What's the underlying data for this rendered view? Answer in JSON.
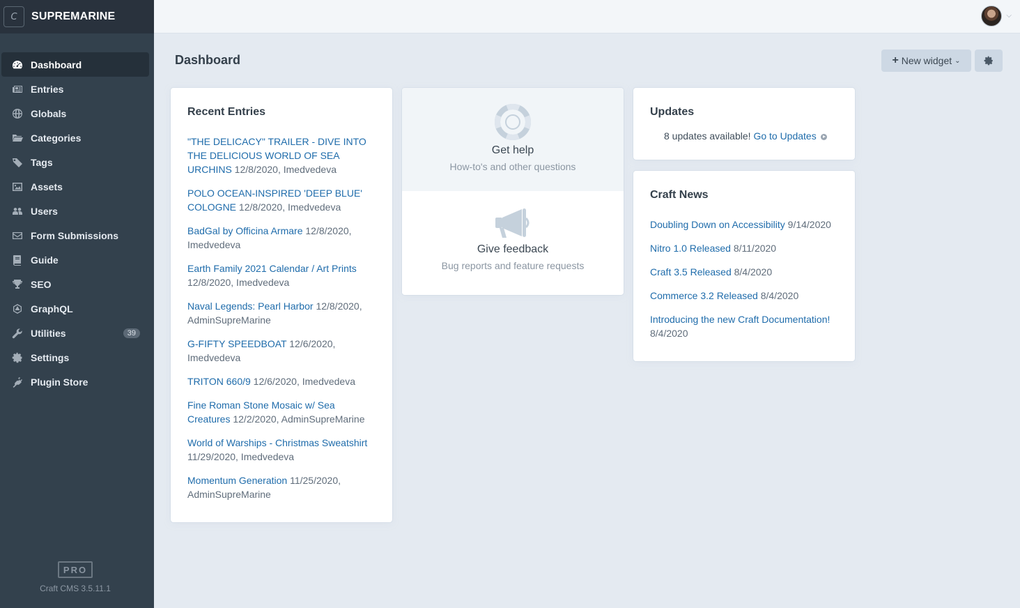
{
  "site": {
    "initial": "C",
    "name": "SUPREMARINE"
  },
  "nav": [
    {
      "label": "Dashboard",
      "icon": "gauge-icon",
      "active": true
    },
    {
      "label": "Entries",
      "icon": "newspaper-icon"
    },
    {
      "label": "Globals",
      "icon": "globe-icon"
    },
    {
      "label": "Categories",
      "icon": "folder-icon"
    },
    {
      "label": "Tags",
      "icon": "tags-icon"
    },
    {
      "label": "Assets",
      "icon": "image-icon"
    },
    {
      "label": "Users",
      "icon": "users-icon"
    },
    {
      "label": "Form Submissions",
      "icon": "envelope-icon"
    },
    {
      "label": "Guide",
      "icon": "book-icon"
    },
    {
      "label": "SEO",
      "icon": "trophy-icon"
    },
    {
      "label": "GraphQL",
      "icon": "graphql-icon"
    },
    {
      "label": "Utilities",
      "icon": "wrench-icon",
      "badge": "39"
    },
    {
      "label": "Settings",
      "icon": "gear-icon"
    },
    {
      "label": "Plugin Store",
      "icon": "plug-icon"
    }
  ],
  "footer": {
    "edition": "PRO",
    "version": "Craft CMS 3.5.11.1"
  },
  "header": {
    "title": "Dashboard",
    "new_widget_label": "New widget"
  },
  "recent_entries": {
    "title": "Recent Entries",
    "items": [
      {
        "title": "\"THE DELICACY\" TRAILER - DIVE INTO THE DELICIOUS WORLD OF SEA URCHINS",
        "meta": "12/8/2020, Imedvedeva"
      },
      {
        "title": "POLO OCEAN-INSPIRED 'DEEP BLUE' COLOGNE",
        "meta": "12/8/2020, Imedvedeva"
      },
      {
        "title": "BadGal by Officina Armare",
        "meta": "12/8/2020, Imedvedeva"
      },
      {
        "title": "Earth Family 2021 Calendar / Art Prints",
        "meta": "12/8/2020, Imedvedeva"
      },
      {
        "title": "Naval Legends: Pearl Harbor",
        "meta": "12/8/2020, AdminSupreMarine"
      },
      {
        "title": "G-FIFTY SPEEDBOAT",
        "meta": "12/6/2020, Imedvedeva"
      },
      {
        "title": "TRITON 660/9",
        "meta": "12/6/2020, Imedvedeva"
      },
      {
        "title": "Fine Roman Stone Mosaic w/ Sea Creatures",
        "meta": "12/2/2020, AdminSupreMarine"
      },
      {
        "title": "World of Warships - Christmas Sweatshirt",
        "meta": "11/29/2020, Imedvedeva"
      },
      {
        "title": "Momentum Generation",
        "meta": "11/25/2020, AdminSupreMarine"
      }
    ]
  },
  "help": {
    "get_help_title": "Get help",
    "get_help_sub": "How-to's and other questions",
    "feedback_title": "Give feedback",
    "feedback_sub": "Bug reports and feature requests"
  },
  "updates": {
    "title": "Updates",
    "count_text": "8 updates available!",
    "link_text": "Go to Updates"
  },
  "news": {
    "title": "Craft News",
    "items": [
      {
        "title": "Doubling Down on Accessibility",
        "date": "9/14/2020"
      },
      {
        "title": "Nitro 1.0 Released",
        "date": "8/11/2020"
      },
      {
        "title": "Craft 3.5 Released",
        "date": "8/4/2020"
      },
      {
        "title": "Commerce 3.2 Released",
        "date": "8/4/2020"
      },
      {
        "title": "Introducing the new Craft Documentation!",
        "date": "8/4/2020"
      }
    ]
  }
}
